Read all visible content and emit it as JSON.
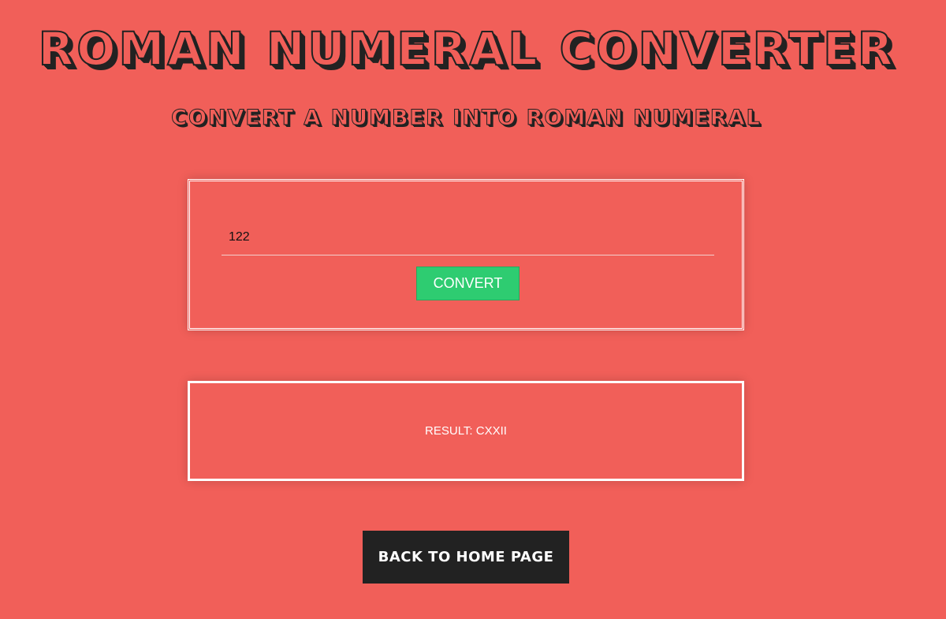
{
  "header": {
    "title": "ROMAN NUMERAL CONVERTER",
    "subtitle": "CONVERT A NUMBER INTO ROMAN NUMERAL"
  },
  "converter": {
    "input_value": "122",
    "convert_label": "CONVERT"
  },
  "result": {
    "text": "RESULT: CXXII"
  },
  "footer": {
    "back_label": "BACK TO HOME PAGE"
  },
  "colors": {
    "background": "#f15f59",
    "convert_button": "#2ecc71",
    "back_button": "#222222",
    "border": "#ffffff"
  }
}
